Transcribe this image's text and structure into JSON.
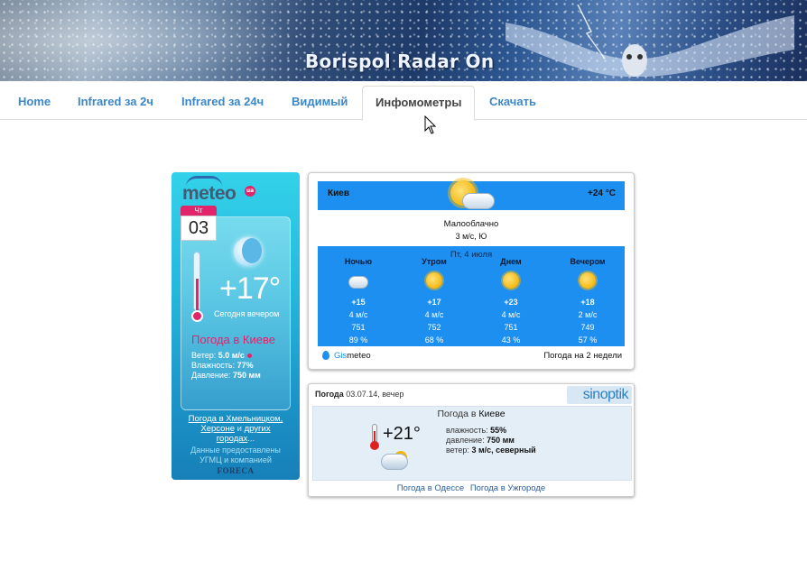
{
  "banner": {
    "title": "Borispol Radar On"
  },
  "nav": {
    "items": [
      {
        "label": "Home"
      },
      {
        "label": "Infrared за 2ч"
      },
      {
        "label": "Infrared за 24ч"
      },
      {
        "label": "Видимый"
      },
      {
        "label": "Инфомометры",
        "active": true
      },
      {
        "label": "Скачать"
      }
    ]
  },
  "meteo": {
    "logo": "meteo",
    "logo_badge": "ua",
    "day": "Чт",
    "date": "03",
    "temp": "+17°",
    "period": "Сегодня вечером",
    "city": "Погода в Киеве",
    "wind_label": "Ветер:",
    "wind_value": "5.0 м/с",
    "humidity_label": "Влажность:",
    "humidity_value": "77%",
    "pressure_label": "Давление:",
    "pressure_value": "750 мм",
    "link_prefix": "Погода в Хмельницком,",
    "link_2": "Херсоне",
    "link_and": "и",
    "link_3": "других",
    "link_4": "городах",
    "link_dots": "...",
    "credit_1": "Данные предоставлены",
    "credit_2": "УГМЦ и компанией",
    "foreca": "FORECA"
  },
  "gismeteo": {
    "city": "Киев",
    "now_temp": "+24 °C",
    "condition": "Малооблачно",
    "wind_now": "3 м/с, Ю",
    "date": "Пт, 4 июля",
    "columns": [
      {
        "label": "Ночью",
        "icon": "cloud-icon",
        "temp": "+15",
        "wind": "4 м/с",
        "pressure": "751",
        "humidity": "89 %"
      },
      {
        "label": "Утром",
        "icon": "sun-icon",
        "temp": "+17",
        "wind": "4 м/с",
        "pressure": "752",
        "humidity": "68 %"
      },
      {
        "label": "Днем",
        "icon": "sun-icon",
        "temp": "+23",
        "wind": "4 м/с",
        "pressure": "751",
        "humidity": "43 %"
      },
      {
        "label": "Вечером",
        "icon": "sun-icon",
        "temp": "+18",
        "wind": "2 м/с",
        "pressure": "749",
        "humidity": "57 %"
      }
    ],
    "brand_prefix": "Gis",
    "brand_suffix": "meteo",
    "two_weeks": "Погода на 2 недели",
    "colors": {
      "panel": "#1c8ff0"
    }
  },
  "sinoptik": {
    "title_bold": "Погода",
    "title_rest": "03.07.14, вечер",
    "logo": "sinoptik",
    "heading_prefix": "Погода в",
    "heading_city": "Киеве",
    "temp": "+21°",
    "humidity_label": "влажность:",
    "humidity_value": "55%",
    "pressure_label": "давление:",
    "pressure_value": "750 мм",
    "wind_label": "ветер:",
    "wind_value": "3 м/с, северный",
    "link_1": "Погода в Одессе",
    "link_2": "Погода в Ужгороде"
  }
}
